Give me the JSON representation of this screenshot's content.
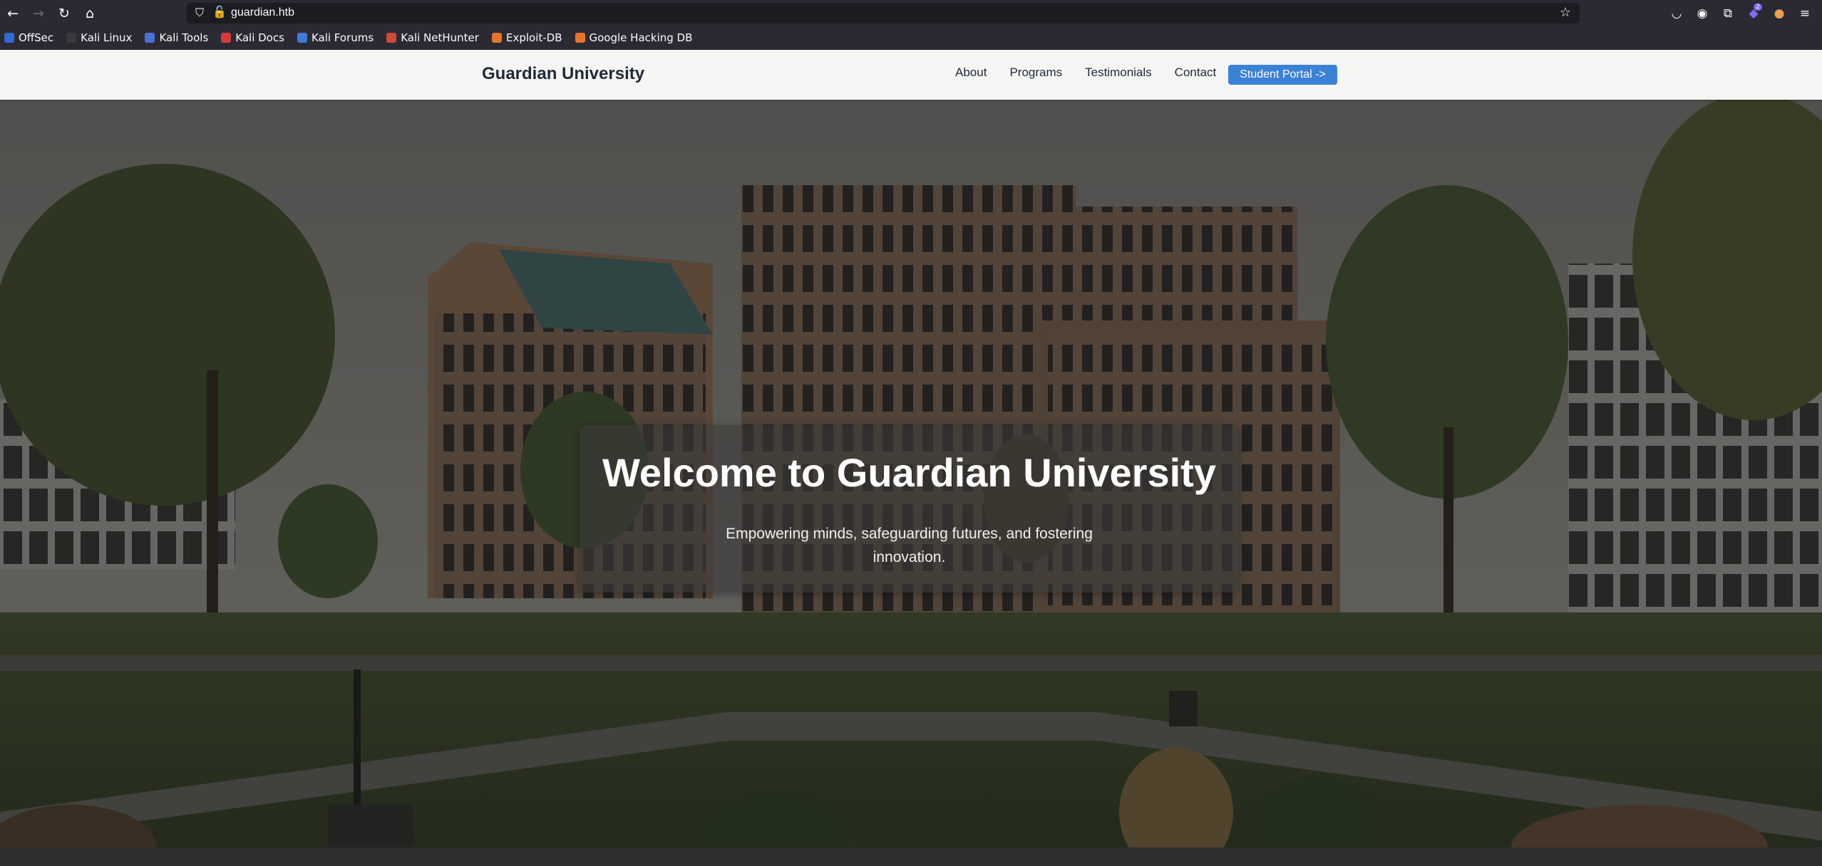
{
  "browser": {
    "url": "guardian.htb",
    "bookmarks": [
      {
        "label": "OffSec",
        "color": "#2c6bd6"
      },
      {
        "label": "Kali Linux",
        "color": "#3a3a3a"
      },
      {
        "label": "Kali Tools",
        "color": "#4a6fd8"
      },
      {
        "label": "Kali Docs",
        "color": "#d33b3b"
      },
      {
        "label": "Kali Forums",
        "color": "#3f7ad6"
      },
      {
        "label": "Kali NetHunter",
        "color": "#d04a3a"
      },
      {
        "label": "Exploit-DB",
        "color": "#e8742c"
      },
      {
        "label": "Google Hacking DB",
        "color": "#e8742c"
      }
    ],
    "extension_badge": "2"
  },
  "site": {
    "brand": "Guardian University",
    "nav": {
      "about": "About",
      "programs": "Programs",
      "testimonials": "Testimonials",
      "contact": "Contact"
    },
    "portal_button": "Student Portal ->",
    "accent_color": "#3b82d6"
  },
  "hero": {
    "title": "Welcome to Guardian University",
    "subtitle": "Empowering minds, safeguarding futures, and fostering innovation."
  }
}
